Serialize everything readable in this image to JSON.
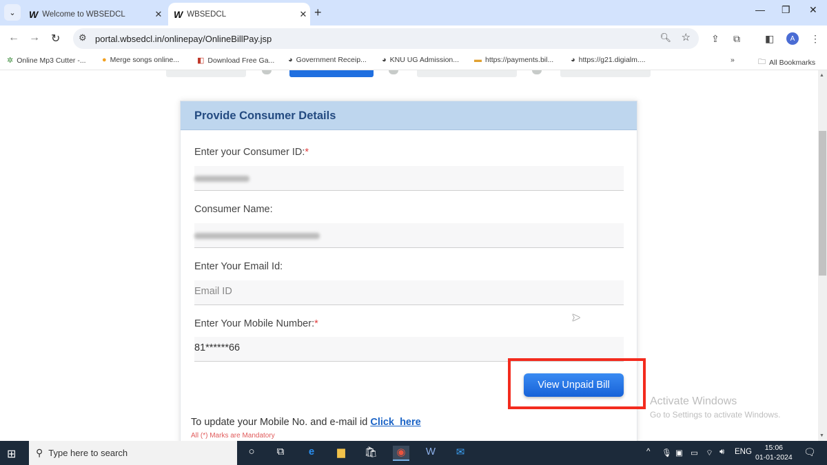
{
  "browser": {
    "tabs": [
      {
        "title": "Welcome to WBSEDCL",
        "favicon": "wbsedcl-logo",
        "active": false
      },
      {
        "title": "WBSEDCL",
        "favicon": "wbsedcl-logo",
        "active": true
      }
    ],
    "new_tab": "+",
    "tab_dropdown": "⌄",
    "window_controls": {
      "minimize": "—",
      "restore": "❐",
      "close": "✕"
    },
    "nav": {
      "back": "←",
      "forward": "→",
      "reload": "↻"
    },
    "url": "portal.wbsedcl.in/onlinepay/OnlineBillPay.jsp",
    "profile_initial": "A",
    "bookmarks": [
      {
        "label": "Online Mp3 Cutter -...",
        "icon": "✲",
        "color": "#3a8a3a"
      },
      {
        "label": "Merge songs online...",
        "icon": "●",
        "color": "#f2a020"
      },
      {
        "label": "Download Free Ga...",
        "icon": "◧",
        "color": "#c0392b"
      },
      {
        "label": "Government Receip...",
        "icon": "◕",
        "color": "#444"
      },
      {
        "label": "KNU UG Admission...",
        "icon": "◕",
        "color": "#444"
      },
      {
        "label": "https://payments.bil...",
        "icon": "▬",
        "color": "#e0a030"
      },
      {
        "label": "https://g21.digialm....",
        "icon": "◕",
        "color": "#444"
      }
    ],
    "bookmarks_overflow": "»",
    "all_bookmarks": "All Bookmarks"
  },
  "form": {
    "title": "Provide Consumer Details",
    "consumer_id": {
      "label": "Enter your Consumer ID:",
      "required": "*",
      "value": "blurred"
    },
    "consumer_name": {
      "label": "Consumer Name:",
      "value": "blurred"
    },
    "email": {
      "label": "Enter Your Email Id:",
      "placeholder": "Email ID",
      "value": ""
    },
    "mobile": {
      "label": "Enter Your Mobile Number:",
      "required": "*",
      "value": "81******66"
    },
    "submit_label": "View Unpaid Bill",
    "update_text": "To update your Mobile No. and e-mail id ",
    "update_link": "Click_here",
    "mandatory_note": "All (*) Marks are Mandatory"
  },
  "watermark": {
    "line1": "Activate Windows",
    "line2": "Go to Settings to activate Windows."
  },
  "taskbar": {
    "search_placeholder": "Type here to search",
    "apps": [
      "cortana",
      "task-view",
      "edge",
      "file-explorer",
      "store",
      "chrome",
      "word",
      "mail"
    ],
    "language": "ENG",
    "time": "15:06",
    "date": "01-01-2024"
  }
}
